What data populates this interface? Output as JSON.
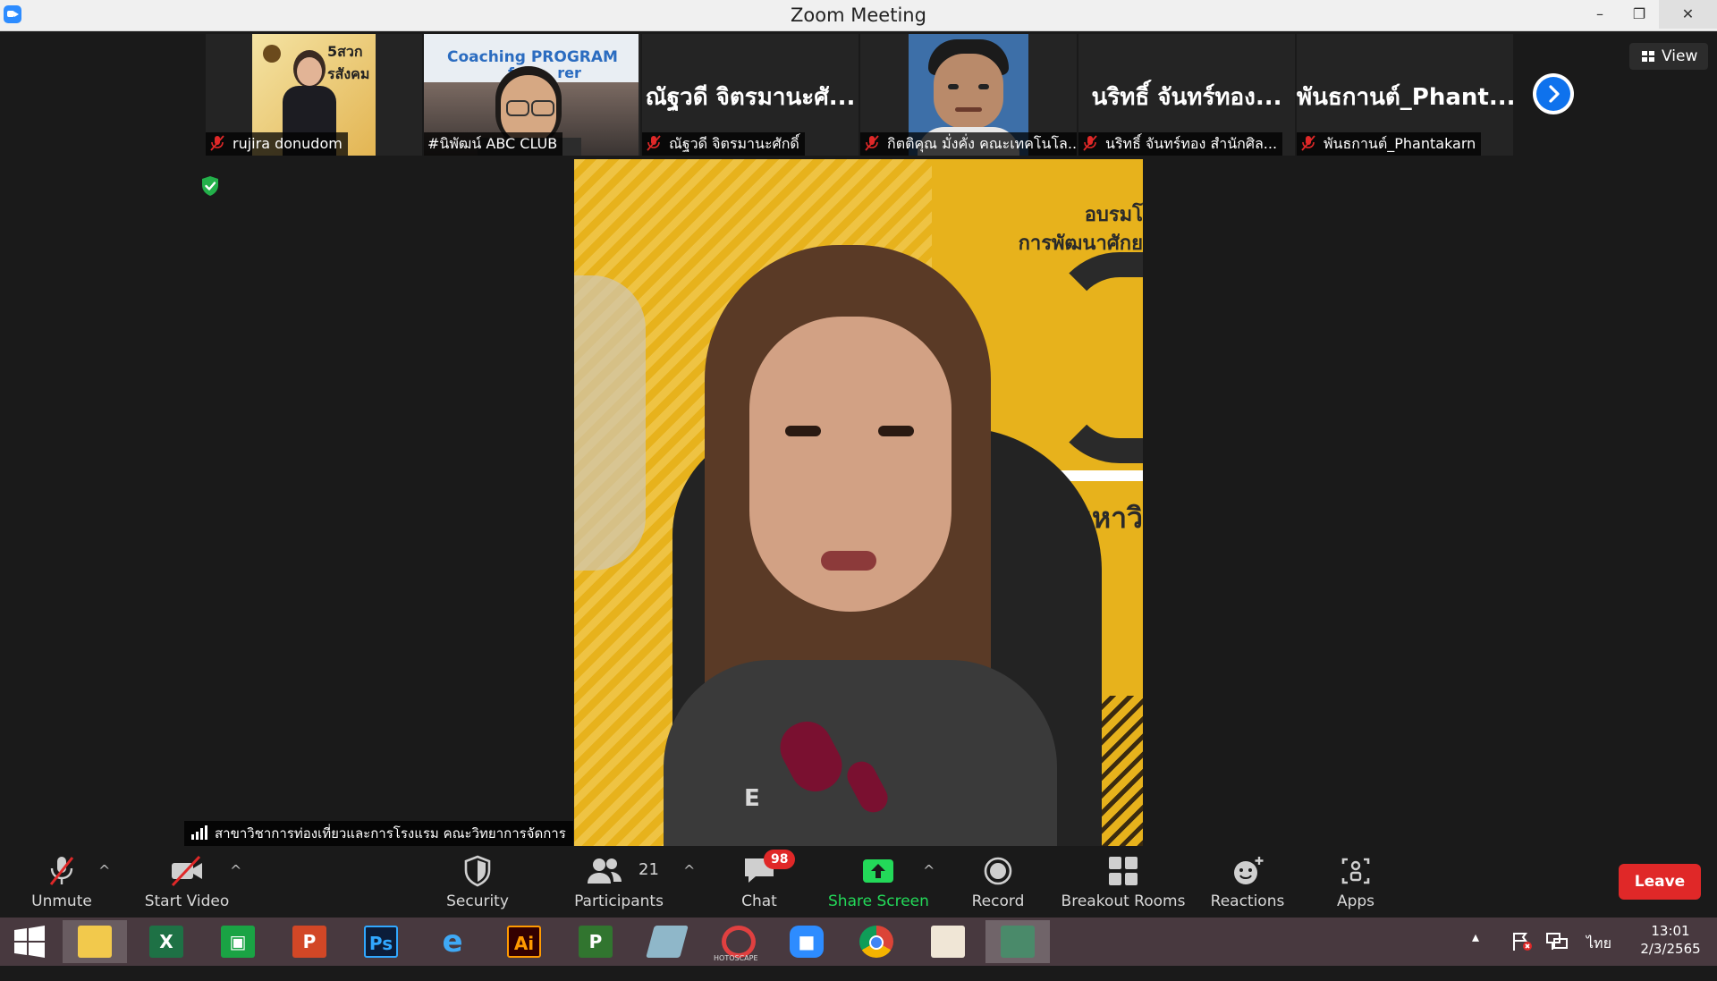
{
  "window": {
    "title": "Zoom Meeting",
    "minimize": "–",
    "restore": "❐",
    "close": "✕"
  },
  "view_button": {
    "label": "View"
  },
  "participants_strip": [
    {
      "caption": "rujira donudom",
      "muted": true,
      "kind": "video",
      "poster_text": "5สวกรสังคม"
    },
    {
      "caption": "#นิพัฒน์ ABC CLUB",
      "muted": false,
      "kind": "video",
      "banner_text": "Coaching PROGRAM",
      "banner_text2": "for ... rer"
    },
    {
      "caption": "ณัฐวดี จิตรมานะศักดิ์",
      "muted": true,
      "kind": "name",
      "display_name": "ณัฐวดี จิตรมานะศั..."
    },
    {
      "caption": "กิตติคุณ มั่งคั่ง คณะเทคโนโล...",
      "muted": true,
      "kind": "avatar"
    },
    {
      "caption": "นริทธิ์ จันทร์ทอง สำนักศิล...",
      "muted": true,
      "kind": "name",
      "display_name": "นริทธิ์ จันทร์ทอง..."
    },
    {
      "caption": "พันธกานต์_Phantakarn",
      "muted": true,
      "kind": "name",
      "display_name": "พันธกานต์_Phant..."
    }
  ],
  "main_video": {
    "background_text_1": "อบรมโ",
    "background_text_2": "การพัฒนาศักย",
    "background_text_3": "มหาวิ",
    "shirt_text": "E"
  },
  "speaker_label": "สาขาวิชาการท่องเที่ยวและการโรงแรม คณะวิทยาการจัดการ",
  "toolbar": {
    "unmute": "Unmute",
    "start_video": "Start Video",
    "security": "Security",
    "participants": "Participants",
    "participants_count": "21",
    "chat": "Chat",
    "chat_badge": "98",
    "share_screen": "Share Screen",
    "record": "Record",
    "breakout_rooms": "Breakout Rooms",
    "reactions": "Reactions",
    "apps": "Apps",
    "leave": "Leave",
    "caret": "^"
  },
  "taskbar": {
    "apps": [
      "windows-start",
      "file-explorer",
      "excel",
      "publisher-green",
      "powerpoint",
      "photoshop",
      "internet-explorer",
      "illustrator",
      "project",
      "pen-app",
      "photoscape",
      "zoom",
      "chrome",
      "paint",
      "screen-app"
    ],
    "ps_label": "Ps",
    "ai_label": "Ai",
    "photoscape_label": "HOTOSCAPE",
    "language": "ไทย",
    "time": "13:01",
    "date": "2/3/2565",
    "tray_up": "▴"
  },
  "colors": {
    "zoom_blue": "#0e72ed",
    "leave_red": "#e02828",
    "share_green": "#23d959",
    "video_yellow": "#e7b21c",
    "taskbar": "#48393f"
  }
}
